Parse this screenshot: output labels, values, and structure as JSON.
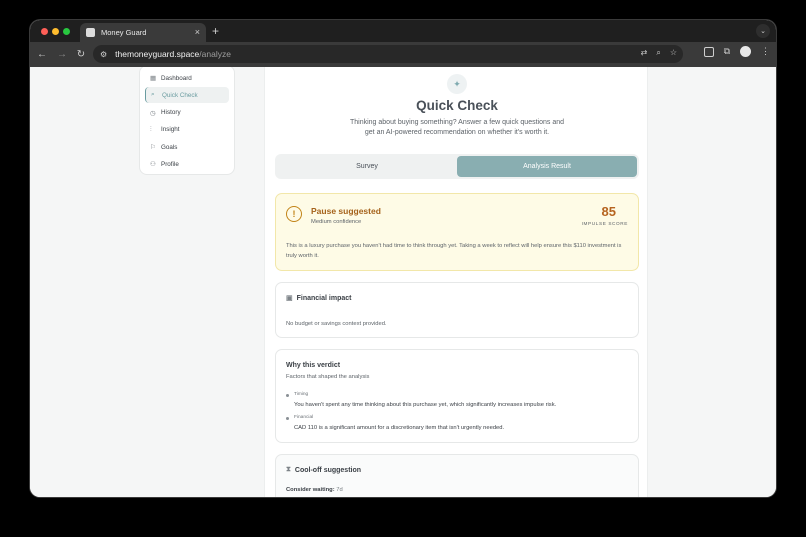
{
  "browser": {
    "tab_title": "Money Guard",
    "url_host": "themoneyguard.space",
    "url_path": "/analyze",
    "new_tab": "+",
    "close": "×"
  },
  "sidebar": {
    "items": [
      {
        "label": "Dashboard",
        "icon": "grid-icon",
        "active": false
      },
      {
        "label": "Quick Check",
        "icon": "search-icon",
        "active": true
      },
      {
        "label": "History",
        "icon": "clock-icon",
        "active": false
      },
      {
        "label": "Insight",
        "icon": "chart-icon",
        "active": false
      },
      {
        "label": "Goals",
        "icon": "flag-icon",
        "active": false
      },
      {
        "label": "Profile",
        "icon": "user-icon",
        "active": false
      }
    ]
  },
  "header": {
    "title": "Quick Check",
    "subtitle": "Thinking about buying something? Answer a few quick questions and get an AI-powered recommendation on whether it's worth it."
  },
  "tabs": [
    {
      "label": "Survey",
      "active": false
    },
    {
      "label": "Analysis Result",
      "active": true
    }
  ],
  "verdict": {
    "title": "Pause suggested",
    "confidence": "Medium confidence",
    "score": "85",
    "score_label": "IMPULSE SCORE",
    "body": "This is a luxury purchase you haven't had time to think through yet. Taking a week to reflect will help ensure this $110 investment is truly worth it."
  },
  "financial": {
    "title": "Financial impact",
    "body": "No budget or savings context provided."
  },
  "why": {
    "title": "Why this verdict",
    "subtitle": "Factors that shaped the analysis",
    "factors": [
      {
        "label": "Timing",
        "text": "You haven't spent any time thinking about this purchase yet, which significantly increases impulse risk."
      },
      {
        "label": "Financial",
        "text": "CAD 110 is a significant amount for a discretionary item that isn't urgently needed."
      }
    ]
  },
  "cooloff": {
    "title": "Cool-off suggestion",
    "label": "Consider waiting:",
    "value": "7d"
  },
  "colors": {
    "accent": "#89aeb1",
    "warning": "#c28418",
    "score": "#b66420"
  }
}
